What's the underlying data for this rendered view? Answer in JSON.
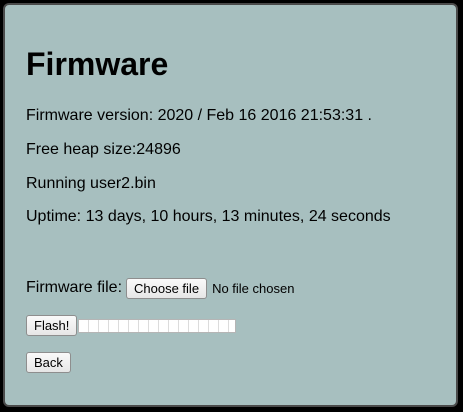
{
  "page": {
    "title": "Firmware"
  },
  "info": {
    "version_line": "Firmware version: 2020 / Feb 16 2016 21:53:31 .",
    "heap_line": "Free heap size:24896",
    "running_line": "Running user2.bin",
    "uptime_line": "Uptime: 13 days, 10 hours, 13 minutes, 24 seconds"
  },
  "upload": {
    "file_label": "Firmware file:",
    "choose_button": "Choose file",
    "file_status": "No file chosen",
    "flash_button": "Flash!",
    "progress_fraction": 0
  },
  "nav": {
    "back_button": "Back"
  },
  "colors": {
    "background": "#a7bfbf",
    "frame_border": "#4a4a4a"
  }
}
